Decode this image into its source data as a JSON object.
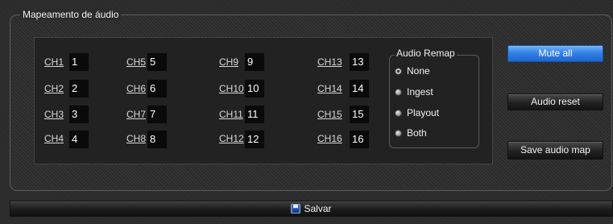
{
  "section_title": "Mapeamento de áudio",
  "channels": [
    {
      "label": "CH1",
      "value": "1"
    },
    {
      "label": "CH2",
      "value": "2"
    },
    {
      "label": "CH3",
      "value": "3"
    },
    {
      "label": "CH4",
      "value": "4"
    },
    {
      "label": "CH5",
      "value": "5"
    },
    {
      "label": "CH6",
      "value": "6"
    },
    {
      "label": "CH7",
      "value": "7"
    },
    {
      "label": "CH8",
      "value": "8"
    },
    {
      "label": "CH9",
      "value": "9"
    },
    {
      "label": "CH10",
      "value": "10"
    },
    {
      "label": "CH11",
      "value": "11"
    },
    {
      "label": "CH12",
      "value": "12"
    },
    {
      "label": "CH13",
      "value": "13"
    },
    {
      "label": "CH14",
      "value": "14"
    },
    {
      "label": "CH15",
      "value": "15"
    },
    {
      "label": "CH16",
      "value": "16"
    }
  ],
  "audio_remap": {
    "title": "Audio Remap",
    "options": [
      "None",
      "Ingest",
      "Playout",
      "Both"
    ],
    "selected": "None"
  },
  "buttons": {
    "mute_all": "Mute all",
    "audio_reset": "Audio reset",
    "save_audio_map": "Save audio map"
  },
  "save_bar": {
    "label": "Salvar",
    "icon": "floppy-disk-icon"
  },
  "colors": {
    "primary_button": "#2f7ee6",
    "background": "#2a2a2a"
  }
}
